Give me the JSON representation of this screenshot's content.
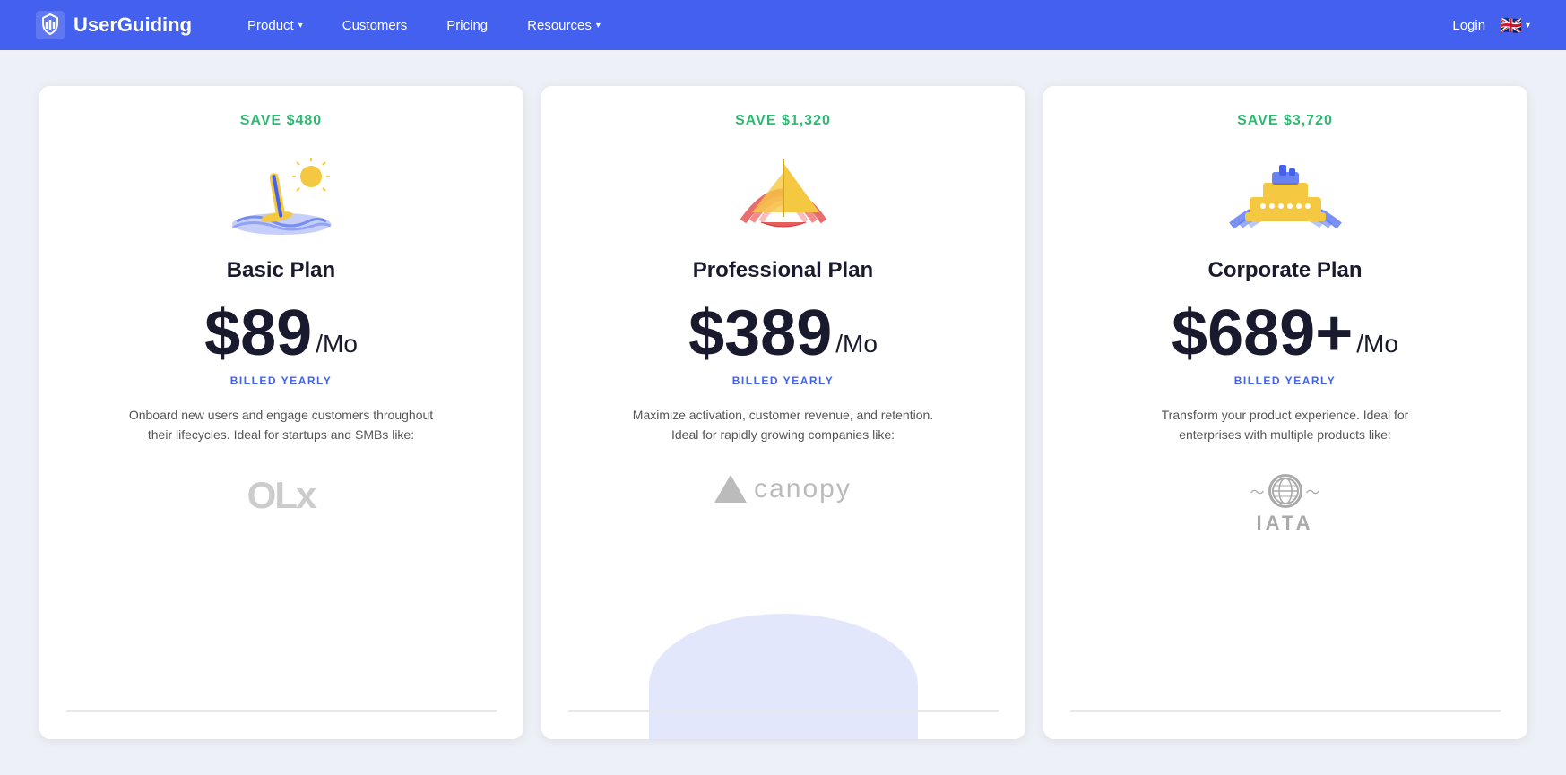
{
  "nav": {
    "logo_text": "UserGuiding",
    "links": [
      {
        "label": "Product",
        "has_dropdown": true
      },
      {
        "label": "Customers",
        "has_dropdown": false
      },
      {
        "label": "Pricing",
        "has_dropdown": false
      },
      {
        "label": "Resources",
        "has_dropdown": true
      }
    ],
    "login_label": "Login",
    "language_flag": "🇬🇧"
  },
  "plans": [
    {
      "id": "basic",
      "save_text": "SAVE ",
      "save_amount": "$480",
      "name": "Basic Plan",
      "price": "$89",
      "period": "/Mo",
      "billed": "BILLED YEARLY",
      "description": "Onboard new users and engage customers throughout their lifecycles. Ideal for startups and SMBs like:",
      "customer": "OLx"
    },
    {
      "id": "professional",
      "save_text": "SAVE ",
      "save_amount": "$1,320",
      "name": "Professional Plan",
      "price": "$389",
      "period": "/Mo",
      "billed": "BILLED YEARLY",
      "description": "Maximize activation, customer revenue, and retention. Ideal for rapidly growing companies like:",
      "customer": "canopy"
    },
    {
      "id": "corporate",
      "save_text": "SAVE ",
      "save_amount": "$3,720",
      "name": "Corporate Plan",
      "price": "$689+",
      "period": "/Mo",
      "billed": "BILLED YEARLY",
      "description": "Transform your product experience. Ideal for enterprises with multiple products like:",
      "customer": "IATA"
    }
  ]
}
